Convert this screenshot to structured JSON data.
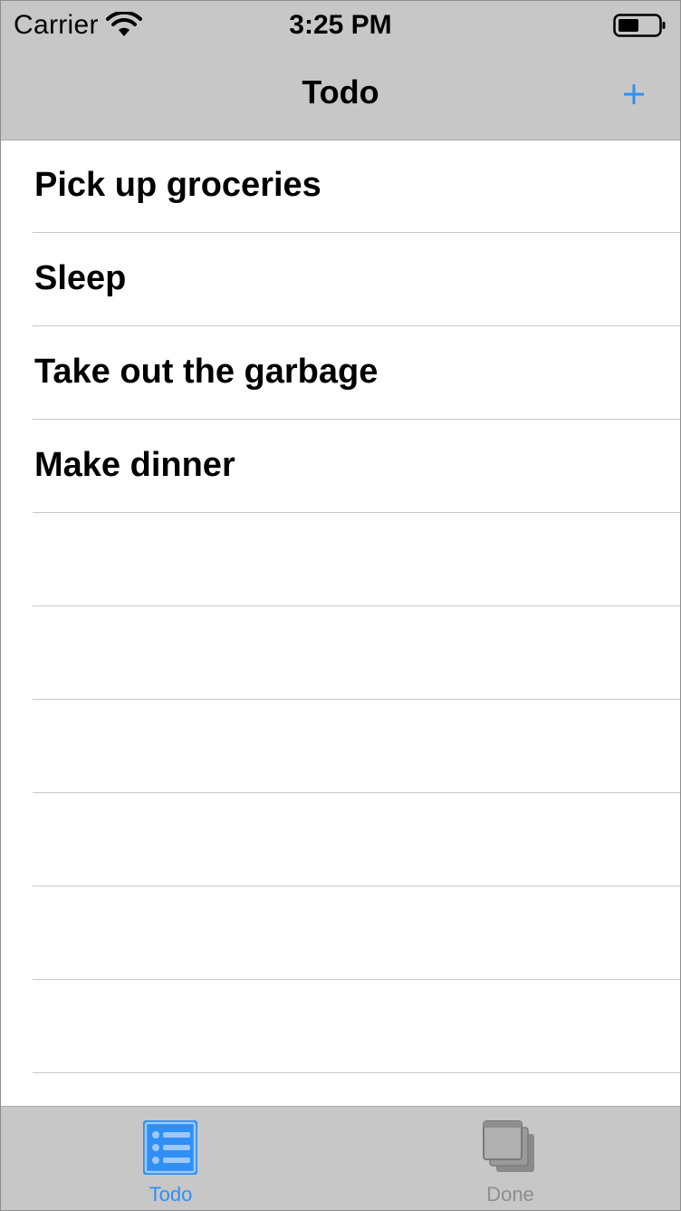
{
  "status_bar": {
    "carrier": "Carrier",
    "time": "3:25 PM",
    "wifi_icon": "wifi-icon",
    "battery_icon": "battery-icon"
  },
  "nav_bar": {
    "title": "Todo",
    "add_label": "+"
  },
  "todo_list": {
    "items": [
      {
        "label": "Pick up groceries"
      },
      {
        "label": "Sleep"
      },
      {
        "label": "Take out the garbage"
      },
      {
        "label": "Make dinner"
      }
    ],
    "empty_rows": 6
  },
  "tab_bar": {
    "tabs": [
      {
        "label": "Todo",
        "icon": "list-icon",
        "selected": true
      },
      {
        "label": "Done",
        "icon": "windows-stack-icon",
        "selected": false
      }
    ]
  },
  "colors": {
    "accent": "#2f8ff5",
    "bar_background": "#c7c7c7",
    "inactive_tab": "#8e8e8e",
    "separator": "#c8c7cc"
  }
}
